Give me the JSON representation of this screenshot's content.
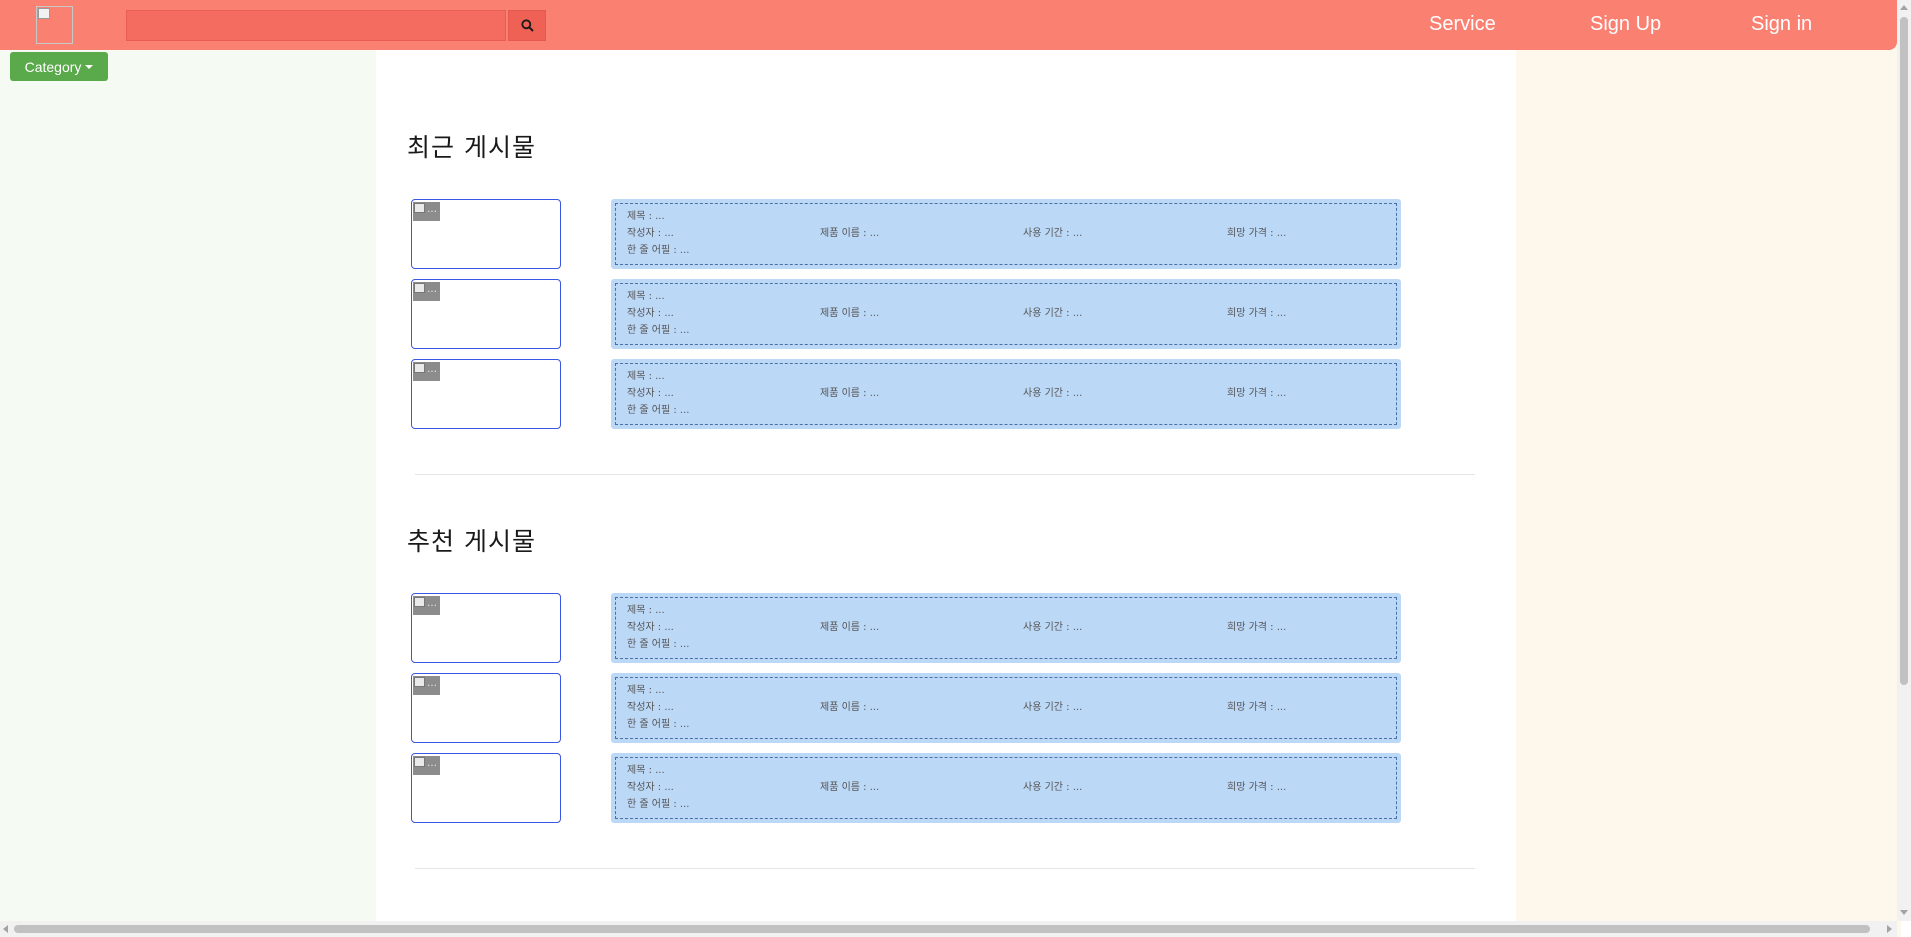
{
  "header": {
    "search_placeholder": "",
    "nav": [
      "Service",
      "Sign Up",
      "Sign in"
    ]
  },
  "category_label": "Category",
  "labels": {
    "title": "제목 : ...",
    "author": "작성자 : ...",
    "product": "제품 이름 : ...",
    "period": "사용 기간 : ...",
    "price": "희망 가격 : ...",
    "comment": "한 줄 어필 : ..."
  },
  "sections": [
    {
      "title": "최근 게시물",
      "post_count": 3
    },
    {
      "title": "추천 게시물",
      "post_count": 3
    }
  ],
  "colors": {
    "header": "#fa8072",
    "category_button": "#5aa94b",
    "card_background": "#bcd8f7",
    "thumb_border": "#3b55e6"
  }
}
